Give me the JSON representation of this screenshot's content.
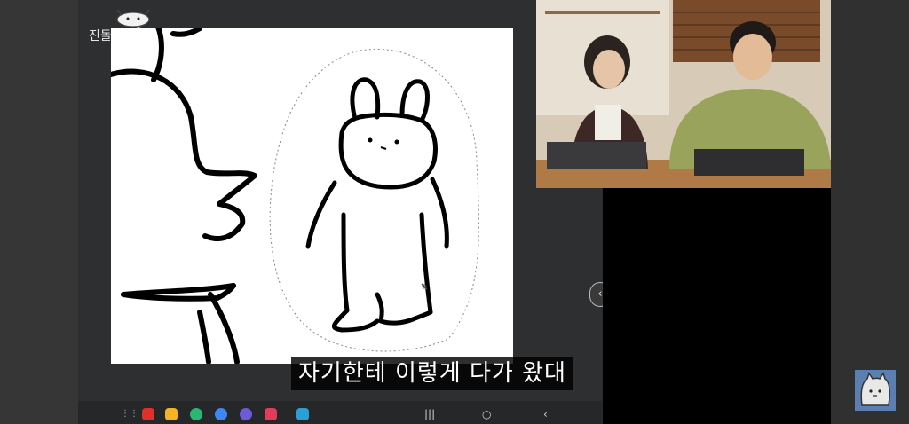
{
  "tablet": {
    "tab_label": "진돌",
    "logo_icon": "pig-doodle-icon",
    "bookmark_icon": "bookmark-icon"
  },
  "canvas": {
    "drawing": "rabbit-doodle-drawing",
    "pen_cursor_icon": "pen-cursor-icon"
  },
  "caption": {
    "text": "자기한테 이렇게 다가 왔대"
  },
  "side_handle": {
    "label": "‹"
  },
  "taskbar": {
    "apps": [
      {
        "name": "apps-grid-icon",
        "color": "#9a9a9a"
      },
      {
        "name": "flipboard-icon",
        "color": "#e0302a"
      },
      {
        "name": "folder-icon",
        "color": "#f5b324"
      },
      {
        "name": "phone-icon",
        "color": "#2bb673"
      },
      {
        "name": "messages-icon",
        "color": "#3f86f5"
      },
      {
        "name": "browser-icon",
        "color": "#6b5bd6"
      },
      {
        "name": "screen-recorder-icon",
        "color": "#e23c5a"
      },
      {
        "name": "calendar-icon",
        "color": "#2a9fd6"
      }
    ],
    "nav": {
      "recents": "|||",
      "home": "○",
      "back": "‹"
    }
  },
  "video_feed": {
    "description_icon": "webcam-feed"
  },
  "channel_avatar": {
    "icon": "cat-avatar-icon",
    "bg": "#5a7fb0"
  }
}
